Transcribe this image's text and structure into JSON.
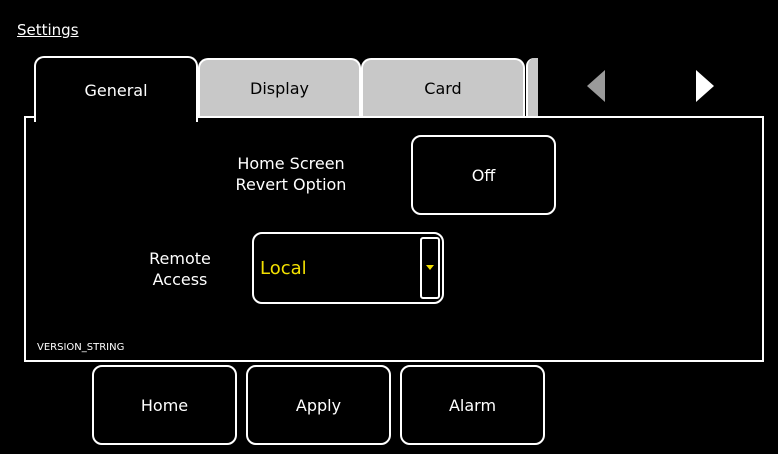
{
  "page": {
    "title": "Settings"
  },
  "tabs": [
    {
      "label": "General",
      "active": true
    },
    {
      "label": "Display",
      "active": false
    },
    {
      "label": "Card",
      "active": false
    }
  ],
  "nav": {
    "prev_icon": "triangle-left-icon",
    "next_icon": "triangle-right-icon"
  },
  "general": {
    "home_revert_label_line1": "Home Screen",
    "home_revert_label_line2": "Revert Option",
    "home_revert_value": "Off",
    "remote_access_label_line1": "Remote",
    "remote_access_label_line2": "Access",
    "remote_access_value": "Local",
    "version": "VERSION_STRING"
  },
  "colors": {
    "selected_value": "#f3e000",
    "inactive_tab": "#c8c8c8",
    "arrow_nav": "#9a9a9a"
  },
  "footer": {
    "home": "Home",
    "apply": "Apply",
    "alarm": "Alarm"
  }
}
